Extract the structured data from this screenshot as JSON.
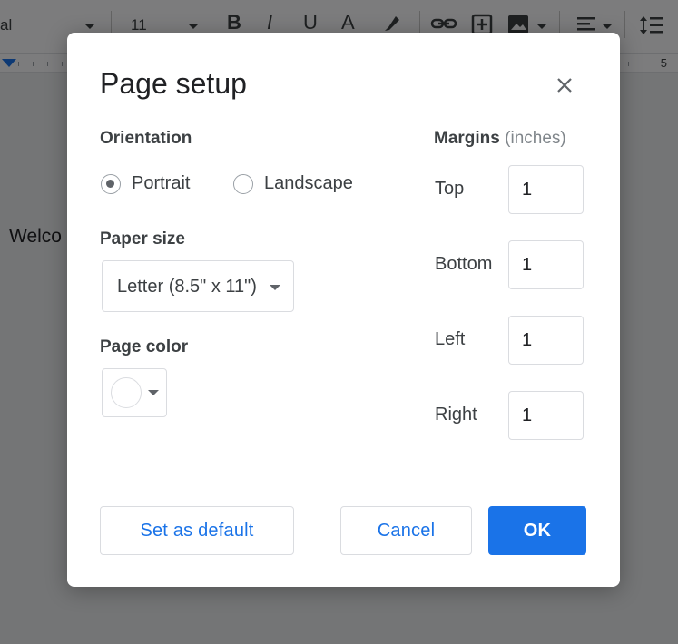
{
  "toolbar": {
    "font_name": "al",
    "font_size": "11",
    "bold_glyph": "B",
    "italic_glyph": "I",
    "underline_glyph": "U",
    "text_color_glyph": "A"
  },
  "ruler": {
    "right_number": "5"
  },
  "document": {
    "visible_text": "Welco"
  },
  "dialog": {
    "title": "Page setup",
    "orientation": {
      "label": "Orientation",
      "options": [
        {
          "label": "Portrait",
          "checked": true
        },
        {
          "label": "Landscape",
          "checked": false
        }
      ]
    },
    "paper_size": {
      "label": "Paper size",
      "value": "Letter (8.5\" x 11\")"
    },
    "page_color": {
      "label": "Page color",
      "value": "#ffffff"
    },
    "margins": {
      "label": "Margins",
      "unit": "(inches)",
      "fields": [
        {
          "label": "Top",
          "value": "1"
        },
        {
          "label": "Bottom",
          "value": "1"
        },
        {
          "label": "Left",
          "value": "1"
        },
        {
          "label": "Right",
          "value": "1"
        }
      ]
    },
    "buttons": {
      "set_default": "Set as default",
      "cancel": "Cancel",
      "ok": "OK"
    }
  },
  "colors": {
    "accent": "#1a73e8",
    "text": "#3c4043",
    "border": "#dadce0"
  }
}
